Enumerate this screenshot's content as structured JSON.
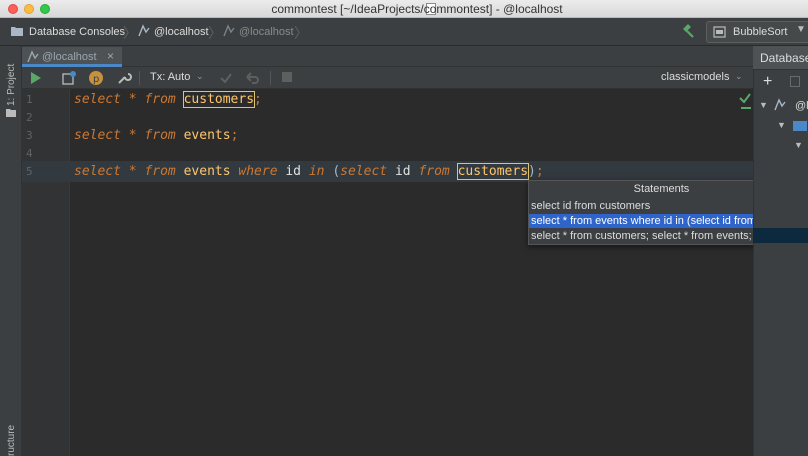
{
  "window": {
    "title": "commontest [~/IdeaProjects/commontest] - @localhost"
  },
  "navbar": {
    "breadcrumb_root": "Database Consoles",
    "breadcrumb_console": "@localhost",
    "breadcrumb_file": "@localhost",
    "run_config": "BubbleSort"
  },
  "left_strip": {
    "project_label": "1: Project",
    "structure_label": "ructure"
  },
  "tab": {
    "label": "@localhost",
    "close": "×"
  },
  "toolbar": {
    "tx_label": "Tx: Auto",
    "schema_label": "classicmodels"
  },
  "editor": {
    "line_numbers": [
      "1",
      "2",
      "3",
      "4",
      "5"
    ],
    "lines": {
      "l1": {
        "kw_select": "select",
        "star": "*",
        "kw_from": "from",
        "table": "customers",
        "semi": ";"
      },
      "l3": {
        "kw_select": "select",
        "star": "*",
        "kw_from": "from",
        "table": "events",
        "semi": ";"
      },
      "l5": {
        "kw_select": "select",
        "star": "*",
        "kw_from": "from",
        "table": "events",
        "kw_where": "where",
        "col": "id",
        "kw_in": "in",
        "paren_open": "(",
        "kw_select2": "select",
        "col2": "id",
        "kw_from2": "from",
        "table2": "customers",
        "paren_close": ")",
        "semi": ";"
      }
    }
  },
  "popup": {
    "title": "Statements",
    "items": [
      "select id from customers",
      "select * from events where id in (select id from c...",
      "select * from customers; select * from events; sel..."
    ],
    "selected_index": 1
  },
  "right_panel": {
    "title": "Database",
    "node_label": "@l"
  },
  "colors": {
    "keyword": "#cc7832",
    "identifier": "#ffc66d",
    "selection": "#2f65ca",
    "run_green": "#59a869",
    "title_bar": "#e0e0e0"
  },
  "icons": [
    "database-folder-icon",
    "sql-console-icon",
    "run-icon",
    "settings-icon",
    "wrench-icon",
    "commit-check-icon",
    "undo-icon",
    "stop-icon",
    "hammer-icon",
    "add-icon"
  ]
}
